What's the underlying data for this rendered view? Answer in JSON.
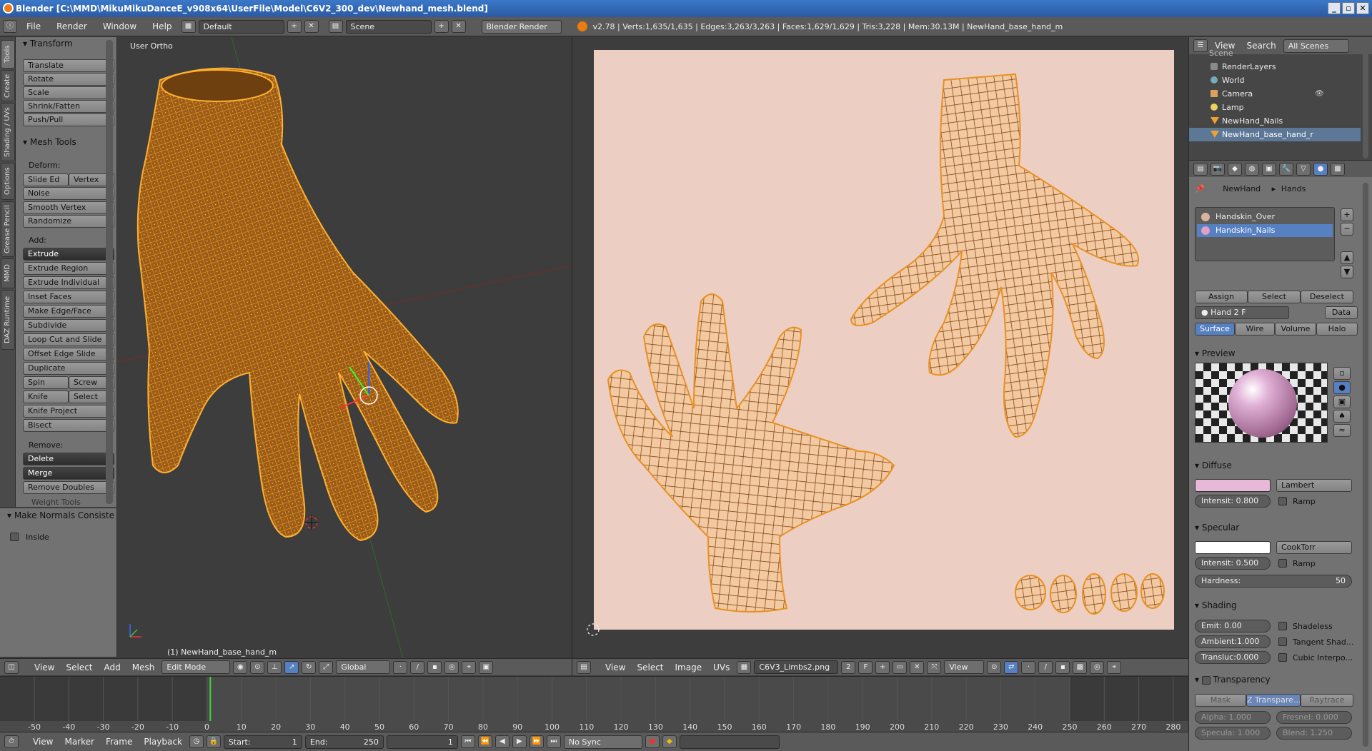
{
  "title": "Blender  [C:\\MMD\\MikuMikuDanceE_v908x64\\UserFile\\Model\\C6V2_300_dev\\Newhand_mesh.blend]",
  "window_controls": [
    "_",
    "▫",
    "✕"
  ],
  "info_header": {
    "menus": [
      "File",
      "Render",
      "Window",
      "Help"
    ],
    "layout": "Default",
    "scene": "Scene",
    "engine": "Blender Render",
    "stats": "v2.78 | Verts:1,635/1,635 | Edges:3,263/3,263 | Faces:1,629/1,629 | Tris:3,228 | Mem:30.13M | NewHand_base_hand_m"
  },
  "tool_tabs": [
    "Tools",
    "Create",
    "Shading / UVs",
    "Options",
    "Grease Pencil",
    "MMD",
    "DAZ Runtime"
  ],
  "tool_panel": {
    "transform_title": "Transform",
    "transform": [
      "Translate",
      "Rotate",
      "Scale",
      "Shrink/Fatten",
      "Push/Pull"
    ],
    "mesh_tools_title": "Mesh Tools",
    "deform_label": "Deform:",
    "slide_edge": "Slide Ed",
    "vertex": "Vertex",
    "noise": "Noise",
    "smooth_vertex": "Smooth Vertex",
    "randomize": "Randomize",
    "add_label": "Add:",
    "extrude": "Extrude",
    "add": [
      "Extrude Region",
      "Extrude Individual",
      "Inset Faces",
      "Make Edge/Face",
      "Subdivide",
      "Loop Cut and Slide",
      "Offset Edge Slide",
      "Duplicate"
    ],
    "spin": "Spin",
    "screw": "Screw",
    "knife": "Knife",
    "select": "Select",
    "knife_project": "Knife Project",
    "bisect": "Bisect",
    "remove_label": "Remove:",
    "delete": "Delete",
    "merge": "Merge",
    "remove_doubles": "Remove Doubles",
    "weight_tools": "Weight Tools"
  },
  "redo_panel": {
    "title": "Make Normals Consiste",
    "inside": "Inside"
  },
  "viewport": {
    "view_label": "User Ortho",
    "object_label": "(1) NewHand_base_hand_m",
    "header_menus": [
      "View",
      "Select",
      "Add",
      "Mesh"
    ],
    "mode": "Edit Mode",
    "orientation": "Global"
  },
  "uv_editor": {
    "header_menus": [
      "View",
      "Select",
      "Image",
      "UVs"
    ],
    "image": "C6V3_Limbs2.png",
    "users": "2",
    "fake": "F",
    "view": "View"
  },
  "timeline": {
    "ticks": [
      -50,
      -40,
      -30,
      -20,
      -10,
      0,
      10,
      20,
      30,
      40,
      50,
      60,
      70,
      80,
      90,
      100,
      110,
      120,
      130,
      140,
      150,
      160,
      170,
      180,
      190,
      200,
      210,
      220,
      230,
      240,
      250,
      260,
      270,
      280
    ],
    "current_frame": 1,
    "menus": [
      "View",
      "Marker",
      "Frame",
      "Playback"
    ],
    "start_label": "Start:",
    "start": "1",
    "end_label": "End:",
    "end": "250",
    "frame": "1",
    "sync": "No Sync"
  },
  "outliner": {
    "menus": [
      "View",
      "Search"
    ],
    "scenes": "All Scenes",
    "items": [
      "Scene",
      "RenderLayers",
      "World",
      "Camera",
      "Lamp",
      "NewHand_Nails",
      "NewHand_base_hand_r"
    ]
  },
  "properties": {
    "breadcrumb_object": "NewHand",
    "breadcrumb_material": "Hands",
    "materials": [
      "Handskin_Over",
      "Handskin_Nails"
    ],
    "assign": "Assign",
    "select": "Select",
    "deselect": "Deselect",
    "mat_name": "Hand",
    "mat_users": "2",
    "mat_f": "F",
    "data": "Data",
    "tabs": [
      "Surface",
      "Wire",
      "Volume",
      "Halo"
    ],
    "preview_title": "Preview",
    "diffuse_title": "Diffuse",
    "diffuse_color": "#e8b8d8",
    "diffuse_shader": "Lambert",
    "diffuse_intensity": "Intensit:  0.800",
    "ramp": "Ramp",
    "specular_title": "Specular",
    "specular_shader": "CookTorr",
    "specular_intensity": "Intensit:  0.500",
    "hardness_label": "Hardness:",
    "hardness": "50",
    "shading_title": "Shading",
    "emit": "Emit:   0.00",
    "shadeless": "Shadeless",
    "ambient": "Ambient:1.000",
    "tangent": "Tangent Shad...",
    "translucency": "Transluc:0.000",
    "cubic": "Cubic Interpo...",
    "transparency_title": "Transparency",
    "trans_modes": [
      "Mask",
      "Z Transpare...",
      "Raytrace"
    ],
    "alpha": "Alpha:  1.000",
    "fresnel": "Fresnel:  0.000",
    "specula": "Specula: 1.000",
    "blend": "Blend:  1.250"
  }
}
